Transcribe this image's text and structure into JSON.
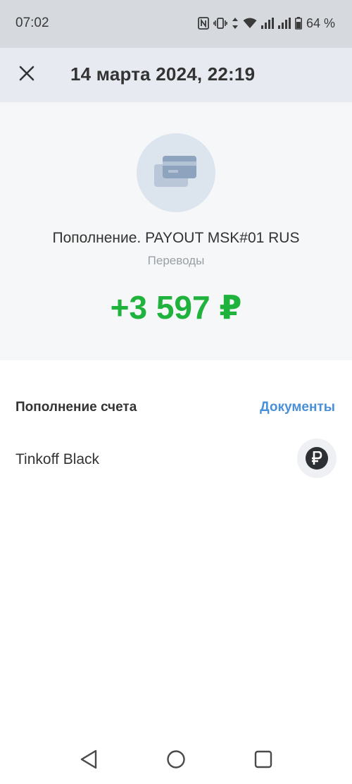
{
  "status_bar": {
    "time": "07:02",
    "battery_percent": "64 %",
    "icons": [
      "nfc-icon",
      "vibrate-icon",
      "data-arrows-icon",
      "wifi-icon",
      "signal-icon",
      "signal-icon",
      "battery-icon"
    ]
  },
  "header": {
    "close_icon": "close-icon",
    "title": "14 марта 2024, 22:19"
  },
  "transaction": {
    "icon": "card-icon",
    "title": "Пополнение. PAYOUT MSK#01 RUS",
    "category": "Переводы",
    "amount": "+3 597 ₽",
    "amount_color": "#1fb33d"
  },
  "details": {
    "section_title": "Пополнение счета",
    "documents_label": "Документы",
    "account_name": "Tinkoff Black",
    "account_icon": "ruble-icon"
  },
  "nav_bar": {
    "buttons": [
      "back-icon",
      "home-icon",
      "recents-icon"
    ]
  },
  "colors": {
    "accent": "#4a90d9",
    "positive": "#1fb33d",
    "header_bg": "#e7ebf1",
    "hero_bg": "#f6f7f8"
  }
}
